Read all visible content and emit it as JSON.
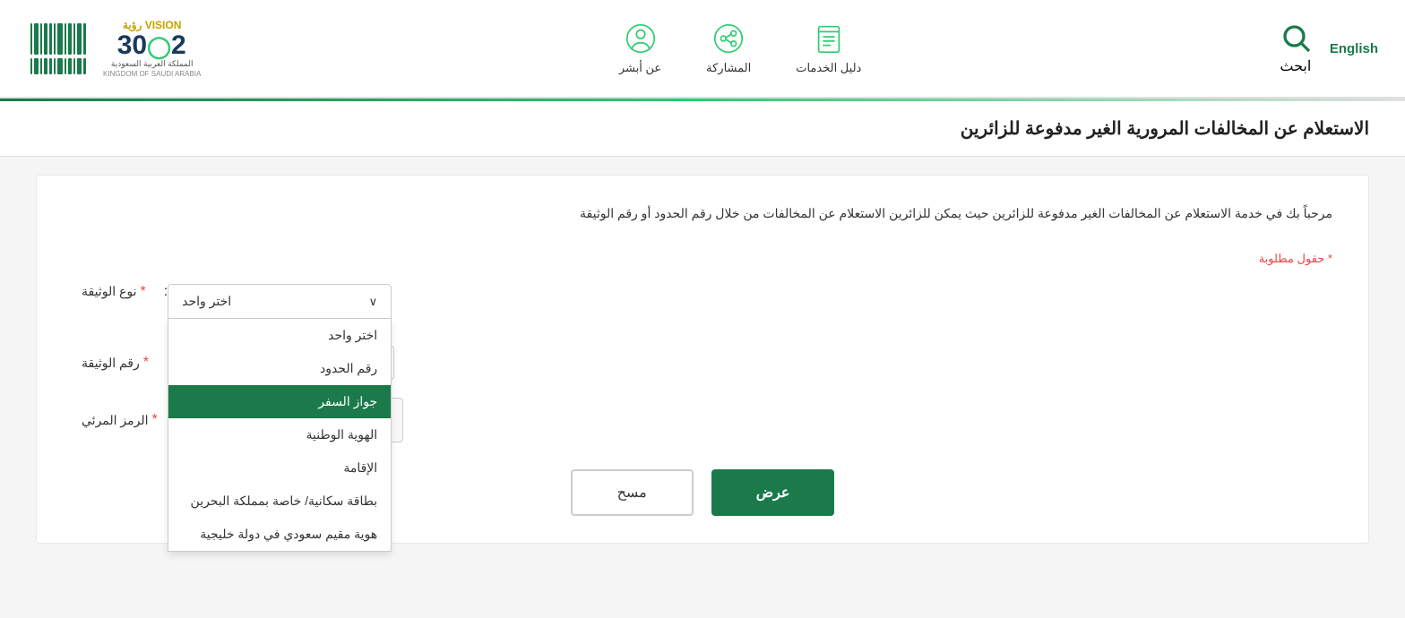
{
  "header": {
    "search_label": "ابحث",
    "lang_label": "English",
    "nav_items": [
      {
        "id": "about",
        "label": "عن أبشر",
        "icon": "person-circle"
      },
      {
        "id": "participation",
        "label": "المشاركة",
        "icon": "share-circle"
      },
      {
        "id": "services",
        "label": "دليل الخدمات",
        "icon": "book"
      }
    ],
    "vision_title": "VISION رؤية",
    "vision_year": "2030",
    "vision_country": "المملكة العربية السعودية",
    "vision_country_en": "KINGDOM OF SAUDI ARABIA"
  },
  "page": {
    "title": "الاستعلام عن المخالفات المرورية الغير مدفوعة للزائرين",
    "welcome": "مرحباً بك في خدمة الاستعلام عن المخالفات الغير مدفوعة للزائرين حيث يمكن للزائرين الاستعلام عن المخالفات من خلال رقم الحدود أو رقم الوثيقة",
    "required_note": "* حقول مطلوبة"
  },
  "form": {
    "doc_type_label": "نوع الوثيقة",
    "doc_type_placeholder": "اختر واحد",
    "doc_type_options": [
      {
        "value": "choose",
        "label": "اختر واحد"
      },
      {
        "value": "border",
        "label": "رقم الحدود"
      },
      {
        "value": "passport",
        "label": "جواز السفر",
        "selected": true
      },
      {
        "value": "national_id",
        "label": "الهوية الوطنية"
      },
      {
        "value": "residence",
        "label": "الإقامة"
      },
      {
        "value": "bahrain",
        "label": "بطاقة سكانية/ خاصة بمملكة البحرين"
      },
      {
        "value": "gulf",
        "label": "هوية مقيم سعودي في دولة خليجية"
      }
    ],
    "doc_number_label": "رقم الوثيقة",
    "doc_number_placeholder": "",
    "captcha_label": "الرمز المرئي",
    "btn_display": "عرض",
    "btn_clear": "مسح"
  }
}
